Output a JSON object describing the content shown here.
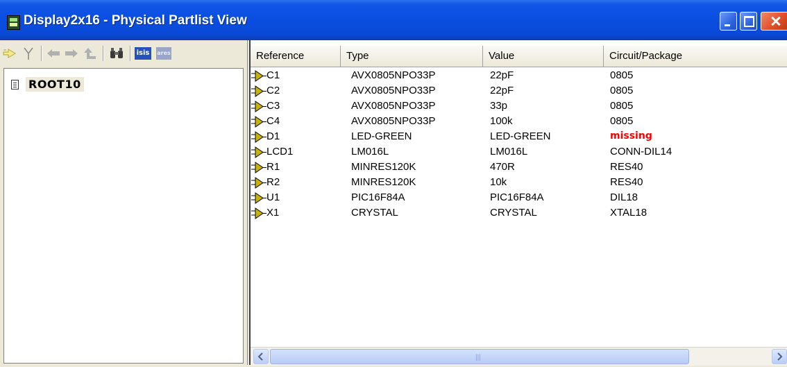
{
  "window": {
    "title": "Display2x16 - Physical Partlist View",
    "app_icon": "display-app-icon",
    "controls": [
      "minimize-button",
      "maximize-button",
      "close-button"
    ]
  },
  "toolbar": {
    "icons": [
      "probe-icon",
      "branch-icon",
      "back-arrow-icon",
      "forward-arrow-icon",
      "up-arrow-icon",
      "binoculars-icon",
      "isis-icon",
      "ares-icon"
    ],
    "isis_label": "isis",
    "ares_label": "ares"
  },
  "tree": {
    "root_label": "ROOT10"
  },
  "table": {
    "columns": [
      "Reference",
      "Type",
      "Value",
      "Circuit/Package"
    ],
    "rows": [
      {
        "reference": "C1",
        "type": "AVX0805NPO33P",
        "value": "22pF",
        "package": "0805"
      },
      {
        "reference": "C2",
        "type": "AVX0805NPO33P",
        "value": "22pF",
        "package": "0805"
      },
      {
        "reference": "C3",
        "type": "AVX0805NPO33P",
        "value": "33p",
        "package": "0805"
      },
      {
        "reference": "C4",
        "type": "AVX0805NPO33P",
        "value": "100k",
        "package": "0805"
      },
      {
        "reference": "D1",
        "type": "LED-GREEN",
        "value": "LED-GREEN",
        "package": "missing"
      },
      {
        "reference": "LCD1",
        "type": "LM016L",
        "value": "LM016L",
        "package": "CONN-DIL14"
      },
      {
        "reference": "R1",
        "type": "MINRES120K",
        "value": "470R",
        "package": "RES40"
      },
      {
        "reference": "R2",
        "type": "MINRES120K",
        "value": "10k",
        "package": "RES40"
      },
      {
        "reference": "U1",
        "type": "PIC16F84A",
        "value": "PIC16F84A",
        "package": "DIL18"
      },
      {
        "reference": "X1",
        "type": "CRYSTAL",
        "value": "CRYSTAL",
        "package": "XTAL18"
      }
    ]
  },
  "colors": {
    "titlebar": "#0a4ee0",
    "missing": "#ff0000",
    "pin_icon": "#c8b400"
  }
}
